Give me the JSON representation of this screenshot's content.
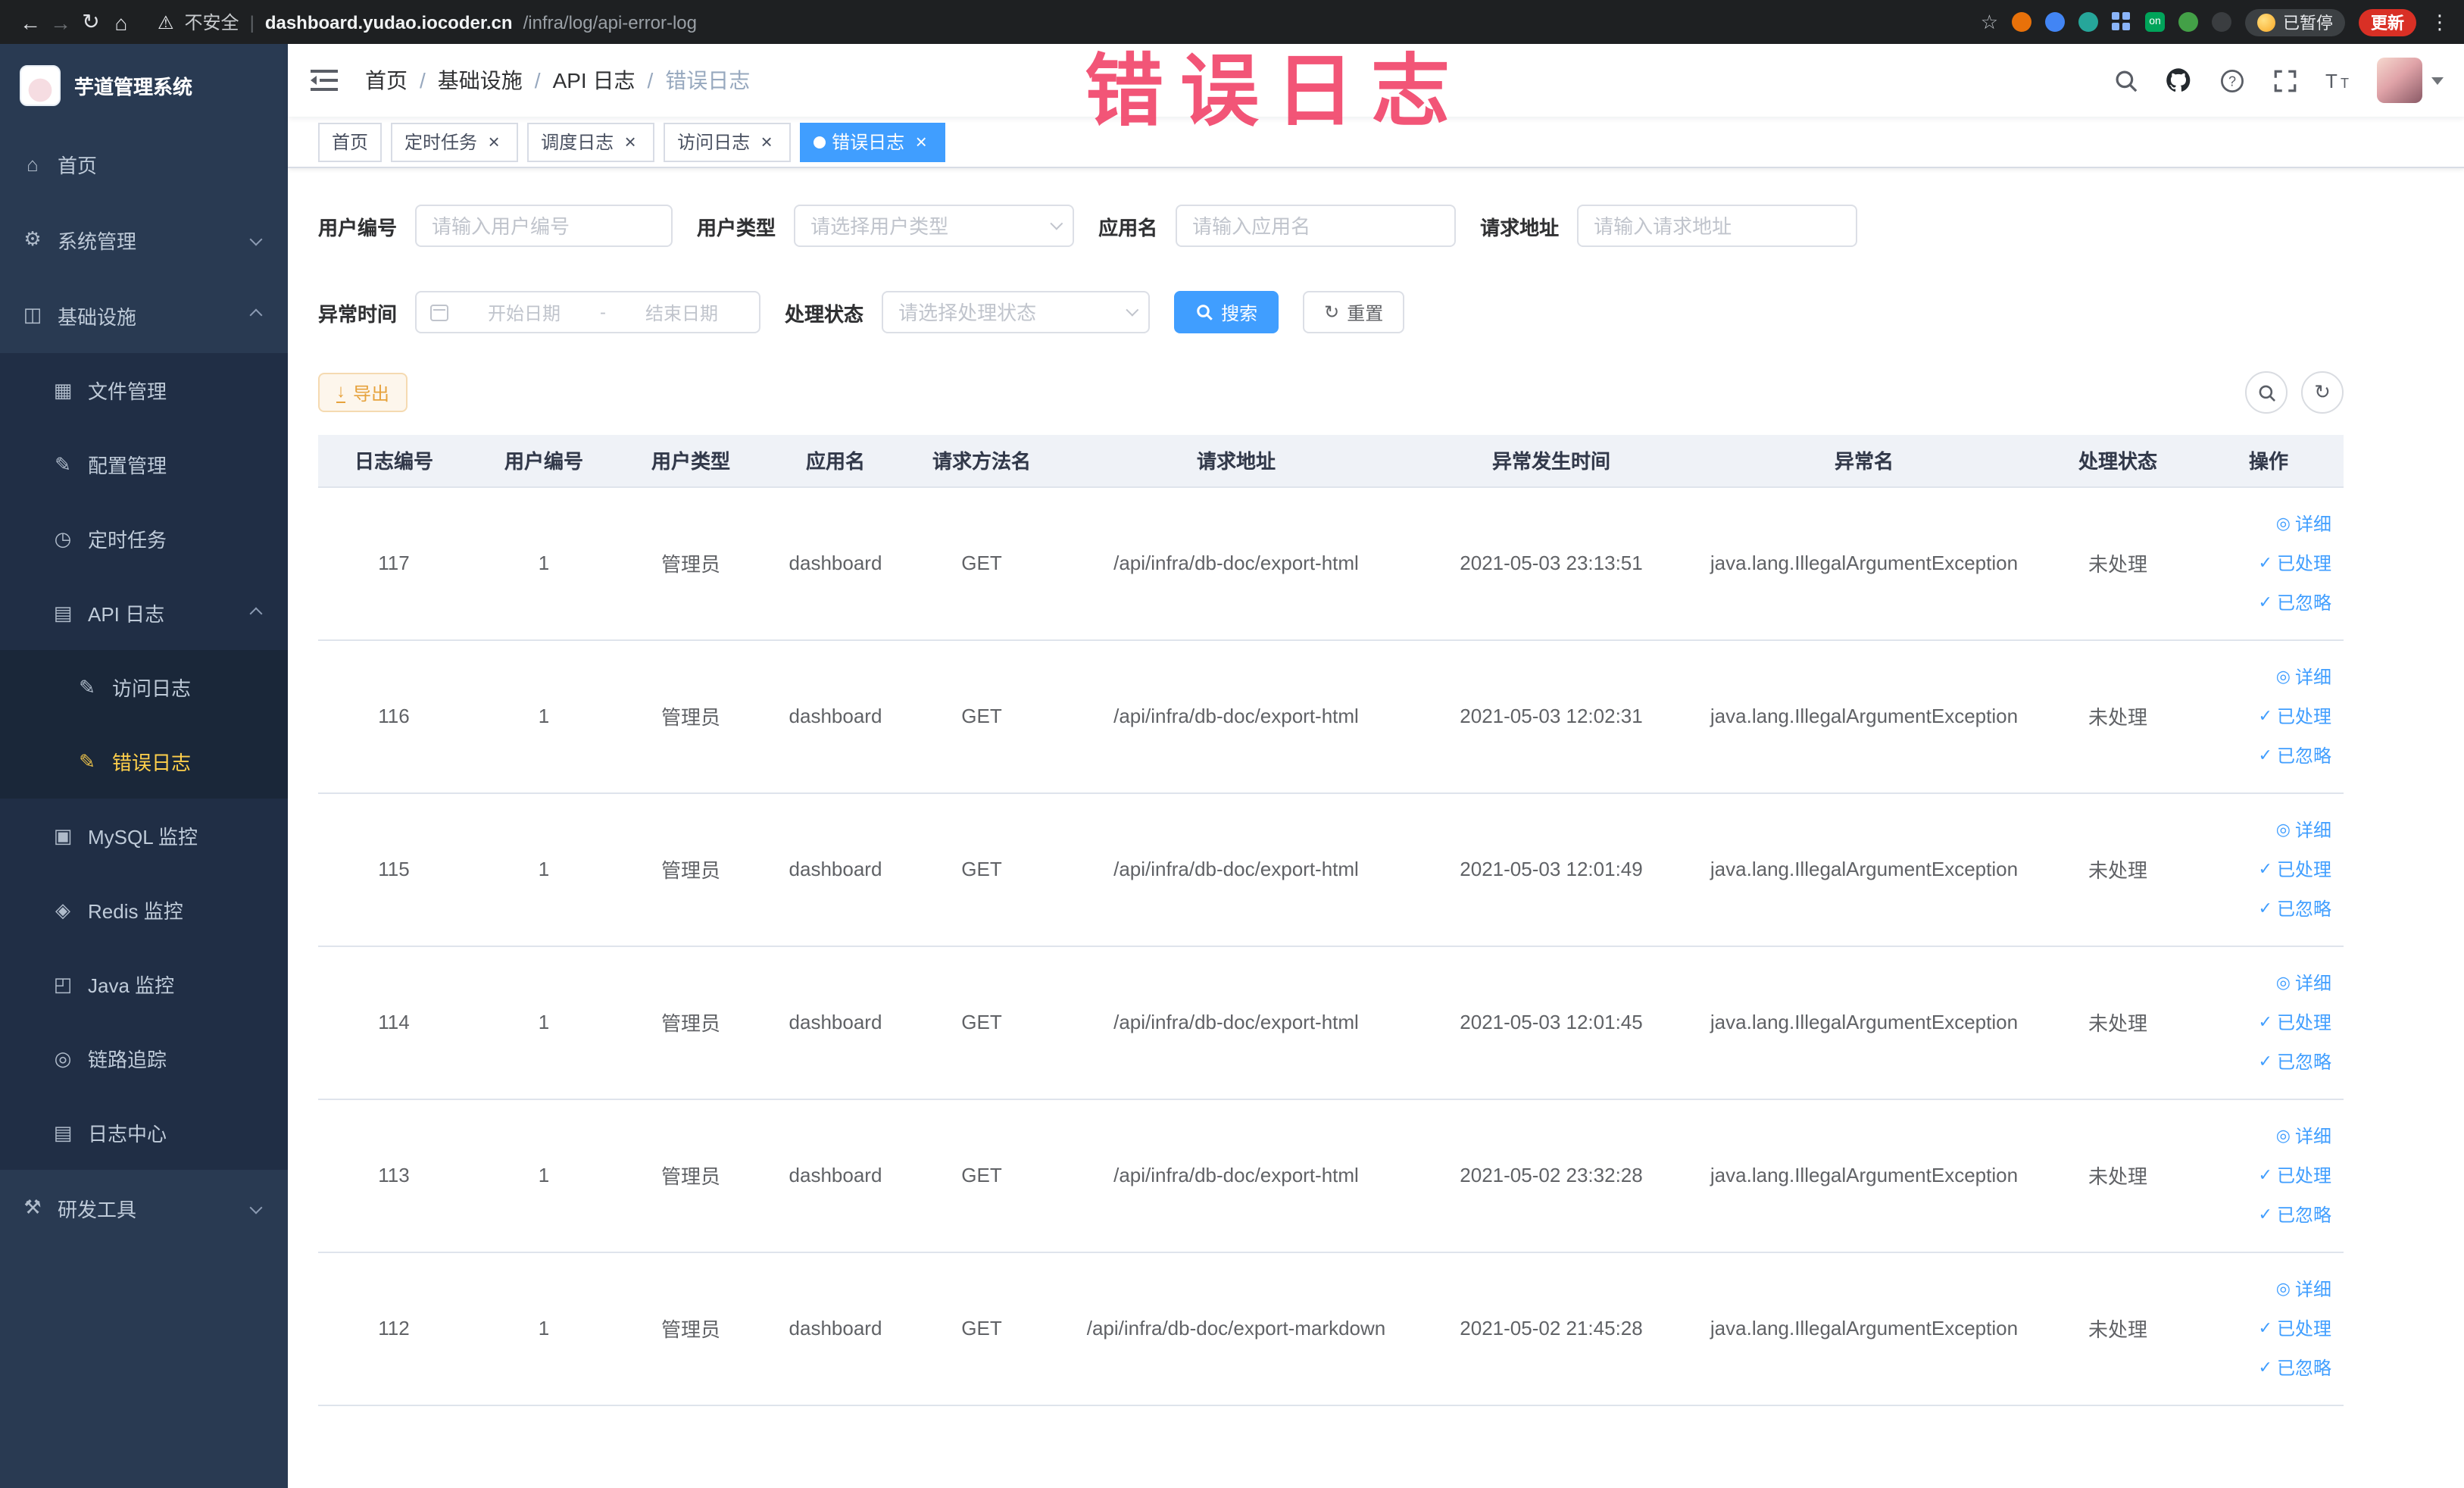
{
  "browser": {
    "warning": "不安全",
    "url_host": "dashboard.yudao.iocoder.cn",
    "url_path": "/infra/log/api-error-log",
    "paused": "已暂停",
    "update": "更新"
  },
  "annotation": "错误日志",
  "sidebar": {
    "logo": "芋道管理系统",
    "items": [
      {
        "label": "首页",
        "icon": "home-icon",
        "level": 1,
        "arrow": "",
        "active": false
      },
      {
        "label": "系统管理",
        "icon": "gear-icon",
        "level": 1,
        "arrow": "down",
        "active": false
      },
      {
        "label": "基础设施",
        "icon": "infrastructure-icon",
        "level": 1,
        "arrow": "up",
        "active": false
      },
      {
        "label": "文件管理",
        "icon": "file-icon",
        "level": 2,
        "arrow": "",
        "active": false
      },
      {
        "label": "配置管理",
        "icon": "config-icon",
        "level": 2,
        "arrow": "",
        "active": false
      },
      {
        "label": "定时任务",
        "icon": "timer-icon",
        "level": 2,
        "arrow": "",
        "active": false
      },
      {
        "label": "API 日志",
        "icon": "api-log-icon",
        "level": 2,
        "arrow": "up",
        "active": false
      },
      {
        "label": "访问日志",
        "icon": "access-log-icon",
        "level": 3,
        "arrow": "",
        "active": false
      },
      {
        "label": "错误日志",
        "icon": "error-log-icon",
        "level": 3,
        "arrow": "",
        "active": true
      },
      {
        "label": "MySQL 监控",
        "icon": "mysql-icon",
        "level": 2,
        "arrow": "",
        "active": false
      },
      {
        "label": "Redis 监控",
        "icon": "redis-icon",
        "level": 2,
        "arrow": "",
        "active": false
      },
      {
        "label": "Java 监控",
        "icon": "java-icon",
        "level": 2,
        "arrow": "",
        "active": false
      },
      {
        "label": "链路追踪",
        "icon": "trace-icon",
        "level": 2,
        "arrow": "",
        "active": false
      },
      {
        "label": "日志中心",
        "icon": "log-center-icon",
        "level": 2,
        "arrow": "",
        "active": false
      },
      {
        "label": "研发工具",
        "icon": "devtools-icon",
        "level": 1,
        "arrow": "down",
        "active": false
      }
    ]
  },
  "breadcrumb": [
    "首页",
    "基础设施",
    "API 日志",
    "错误日志"
  ],
  "tabs": [
    {
      "label": "首页",
      "closable": false,
      "active": false
    },
    {
      "label": "定时任务",
      "closable": true,
      "active": false
    },
    {
      "label": "调度日志",
      "closable": true,
      "active": false
    },
    {
      "label": "访问日志",
      "closable": true,
      "active": false
    },
    {
      "label": "错误日志",
      "closable": true,
      "active": true
    }
  ],
  "filters": {
    "user_id_label": "用户编号",
    "user_id_placeholder": "请输入用户编号",
    "user_type_label": "用户类型",
    "user_type_placeholder": "请选择用户类型",
    "app_name_label": "应用名",
    "app_name_placeholder": "请输入应用名",
    "request_url_label": "请求地址",
    "request_url_placeholder": "请输入请求地址",
    "exception_time_label": "异常时间",
    "date_start_placeholder": "开始日期",
    "date_separator": "-",
    "date_end_placeholder": "结束日期",
    "status_label": "处理状态",
    "status_placeholder": "请选择处理状态",
    "search_button": "搜索",
    "reset_button": "重置"
  },
  "toolbar": {
    "export_button": "导出"
  },
  "table": {
    "columns": [
      "日志编号",
      "用户编号",
      "用户类型",
      "应用名",
      "请求方法名",
      "请求地址",
      "异常发生时间",
      "异常名",
      "处理状态",
      "操作"
    ],
    "actions": [
      "详细",
      "已处理",
      "已忽略"
    ],
    "rows": [
      {
        "log_id": "117",
        "user_id": "1",
        "user_type": "管理员",
        "app": "dashboard",
        "method": "GET",
        "url": "/api/infra/db-doc/export-html",
        "time": "2021-05-03 23:13:51",
        "exception": "java.lang.IllegalArgumentException",
        "status": "未处理"
      },
      {
        "log_id": "116",
        "user_id": "1",
        "user_type": "管理员",
        "app": "dashboard",
        "method": "GET",
        "url": "/api/infra/db-doc/export-html",
        "time": "2021-05-03 12:02:31",
        "exception": "java.lang.IllegalArgumentException",
        "status": "未处理"
      },
      {
        "log_id": "115",
        "user_id": "1",
        "user_type": "管理员",
        "app": "dashboard",
        "method": "GET",
        "url": "/api/infra/db-doc/export-html",
        "time": "2021-05-03 12:01:49",
        "exception": "java.lang.IllegalArgumentException",
        "status": "未处理"
      },
      {
        "log_id": "114",
        "user_id": "1",
        "user_type": "管理员",
        "app": "dashboard",
        "method": "GET",
        "url": "/api/infra/db-doc/export-html",
        "time": "2021-05-03 12:01:45",
        "exception": "java.lang.IllegalArgumentException",
        "status": "未处理"
      },
      {
        "log_id": "113",
        "user_id": "1",
        "user_type": "管理员",
        "app": "dashboard",
        "method": "GET",
        "url": "/api/infra/db-doc/export-html",
        "time": "2021-05-02 23:32:28",
        "exception": "java.lang.IllegalArgumentException",
        "status": "未处理"
      },
      {
        "log_id": "112",
        "user_id": "1",
        "user_type": "管理员",
        "app": "dashboard",
        "method": "GET",
        "url": "/api/infra/db-doc/export-markdown",
        "time": "2021-05-02 21:45:28",
        "exception": "java.lang.IllegalArgumentException",
        "status": "未处理"
      }
    ]
  },
  "colors": {
    "primary": "#409eff",
    "sidebar_active": "#ffd04b",
    "warning_text": "#e6a23c",
    "annotation": "#f14368",
    "update_badge": "#d93025"
  }
}
